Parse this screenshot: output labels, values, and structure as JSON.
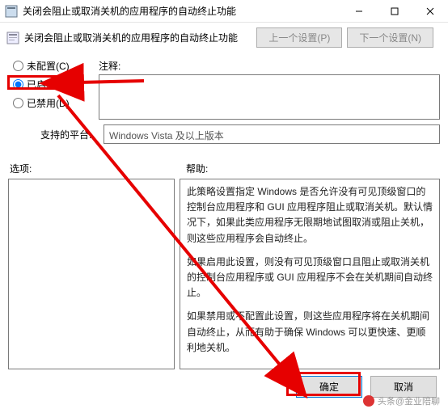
{
  "window": {
    "title": "关闭会阻止或取消关机的应用程序的自动终止功能",
    "subtitle": "关闭会阻止或取消关机的应用程序的自动终止功能"
  },
  "nav": {
    "prev": "上一个设置(P)",
    "next": "下一个设置(N)"
  },
  "radios": {
    "not_configured": "未配置",
    "not_configured_key": "(C)",
    "enabled": "已启用",
    "enabled_key": "(E)",
    "disabled": "已禁用",
    "disabled_key": "(D)"
  },
  "labels": {
    "comment": "注释:",
    "platform": "支持的平台:",
    "options": "选项:",
    "help": "帮助:"
  },
  "platform_value": "Windows Vista 及以上版本",
  "help_text": {
    "p1": "此策略设置指定 Windows 是否允许没有可见顶级窗口的控制台应用程序和 GUI 应用程序阻止或取消关机。默认情况下，如果此类应用程序无限期地试图取消或阻止关机，则这些应用程序会自动终止。",
    "p2": "如果启用此设置，则没有可见顶级窗口且阻止或取消关机的控制台应用程序或 GUI 应用程序不会在关机期间自动终止。",
    "p3": "如果禁用或不配置此设置，则这些应用程序将在关机期间自动终止，从而有助于确保 Windows 可以更快速、更顺利地关机。"
  },
  "footer": {
    "ok": "确定",
    "cancel": "取消"
  },
  "watermark": "头条@金业陪聊"
}
